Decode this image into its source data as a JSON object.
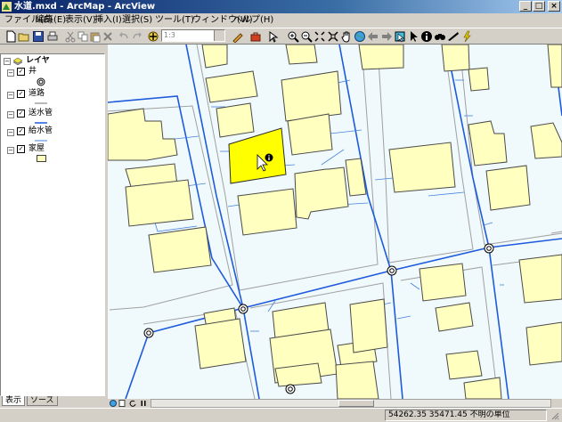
{
  "window": {
    "title": "水道.mxd - ArcMap - ArcView",
    "minimize_glyph": "_",
    "maximize_glyph": "□",
    "close_glyph": "×"
  },
  "menubar": {
    "items": [
      "ファイル(E)",
      "編集(E)",
      "表示(V)",
      "挿入(I)",
      "選択(S)",
      "ツール(T)",
      "ウィンドウ(W)",
      "ヘルプ(H)"
    ]
  },
  "toolbar": {
    "scale_value": "1:3"
  },
  "toc": {
    "root_label": "レイヤ",
    "layers": [
      {
        "name": "井",
        "checked": true,
        "symbol": "well-circle"
      },
      {
        "name": "道路",
        "checked": true,
        "symbol": "gray-line"
      },
      {
        "name": "送水管",
        "checked": true,
        "symbol": "blue-line"
      },
      {
        "name": "給水管",
        "checked": true,
        "symbol": "blue-line"
      },
      {
        "name": "家屋",
        "checked": true,
        "symbol": "beige-fill"
      }
    ],
    "check_glyph": "✓",
    "collapse_glyph": "−"
  },
  "tabs": {
    "display": "表示",
    "source": "ソース"
  },
  "status": {
    "coordinates": "54262.35  35471.45 不明の単位"
  },
  "colors": {
    "building_fill": "#ffffc0",
    "building_stroke": "#4a4a4a",
    "selected_building": "#ffff00",
    "water_main": "#1e5adc",
    "service_pipe": "#4682dc",
    "road_edge": "#a0a0a0",
    "map_background": "#f0fafc"
  }
}
